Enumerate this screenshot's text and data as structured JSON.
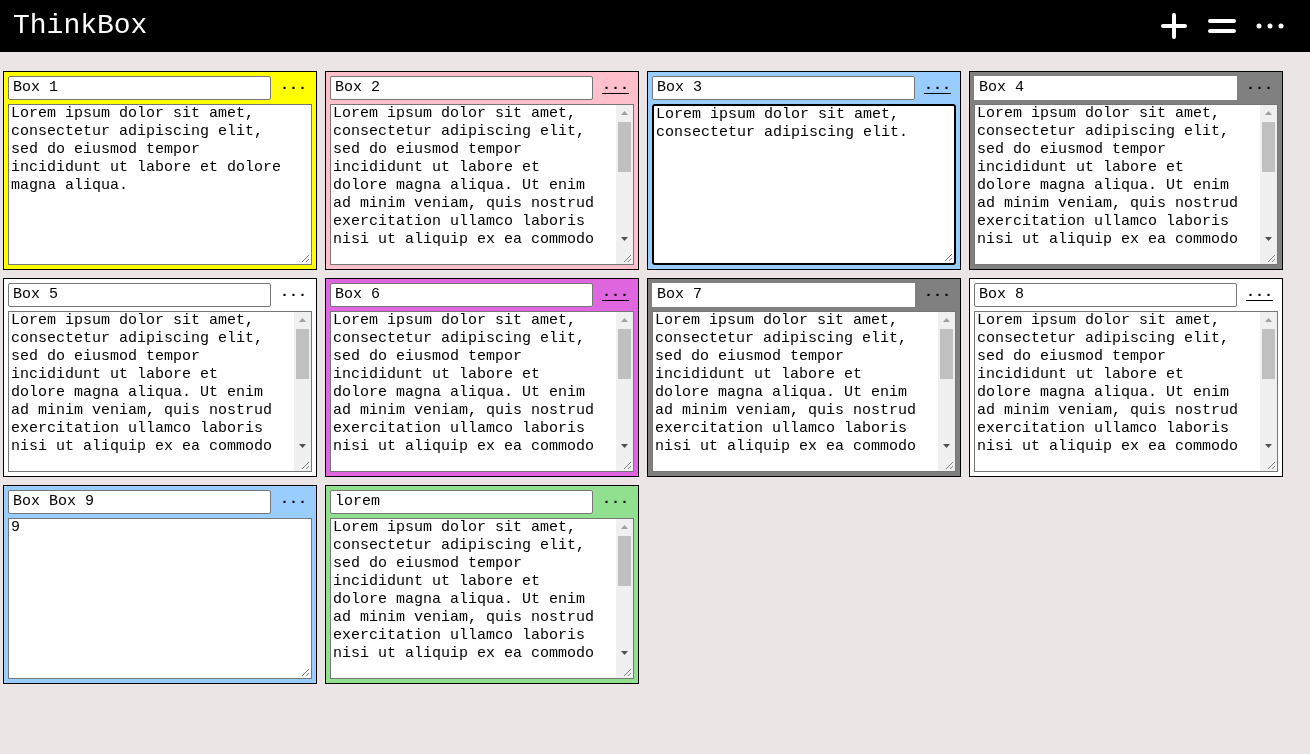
{
  "app": {
    "title": "ThinkBox",
    "actions": [
      {
        "kind": "add"
      },
      {
        "kind": "list"
      },
      {
        "kind": "more"
      }
    ]
  },
  "boxes": [
    {
      "title": "Box 1",
      "color": "#ffff00",
      "menu": "···",
      "menu_underlined": false,
      "focused": false,
      "scrollable": false,
      "text": "Lorem ipsum dolor sit amet, consectetur adipiscing elit, sed do eiusmod tempor incididunt ut labore et dolore magna aliqua."
    },
    {
      "title": "Box 2",
      "color": "#ffc0cb",
      "menu": "···",
      "menu_underlined": true,
      "focused": false,
      "scrollable": true,
      "text": "Lorem ipsum dolor sit amet, consectetur adipiscing elit, sed do eiusmod tempor incididunt ut labore et dolore magna aliqua. Ut enim ad minim veniam, quis nostrud exercitation ullamco laboris nisi ut aliquip ex ea commodo"
    },
    {
      "title": "Box 3",
      "color": "#99ccff",
      "menu": "···",
      "menu_underlined": true,
      "focused": true,
      "scrollable": false,
      "text": "Lorem ipsum dolor sit amet, consectetur adipiscing elit."
    },
    {
      "title": "Box 4",
      "color": "#808080",
      "menu": "···",
      "menu_underlined": false,
      "focused": false,
      "scrollable": true,
      "text": "Lorem ipsum dolor sit amet, consectetur adipiscing elit, sed do eiusmod tempor incididunt ut labore et dolore magna aliqua. Ut enim ad minim veniam, quis nostrud exercitation ullamco laboris nisi ut aliquip ex ea commodo"
    },
    {
      "title": "Box 5",
      "color": "#ffffff",
      "menu": "···",
      "menu_underlined": false,
      "focused": false,
      "scrollable": true,
      "text": "Lorem ipsum dolor sit amet, consectetur adipiscing elit, sed do eiusmod tempor incididunt ut labore et dolore magna aliqua. Ut enim ad minim veniam, quis nostrud exercitation ullamco laboris nisi ut aliquip ex ea commodo"
    },
    {
      "title": "Box 6",
      "color": "#e066e0",
      "menu": "···",
      "menu_underlined": true,
      "focused": false,
      "scrollable": true,
      "text": "Lorem ipsum dolor sit amet, consectetur adipiscing elit, sed do eiusmod tempor incididunt ut labore et dolore magna aliqua. Ut enim ad minim veniam, quis nostrud exercitation ullamco laboris nisi ut aliquip ex ea commodo"
    },
    {
      "title": "Box 7",
      "color": "#808080",
      "menu": "···",
      "menu_underlined": false,
      "focused": false,
      "scrollable": true,
      "text": "Lorem ipsum dolor sit amet, consectetur adipiscing elit, sed do eiusmod tempor incididunt ut labore et dolore magna aliqua. Ut enim ad minim veniam, quis nostrud exercitation ullamco laboris nisi ut aliquip ex ea commodo"
    },
    {
      "title": "Box 8",
      "color": "#ffffff",
      "menu": "···",
      "menu_underlined": true,
      "focused": false,
      "scrollable": true,
      "text": "Lorem ipsum dolor sit amet, consectetur adipiscing elit, sed do eiusmod tempor incididunt ut labore et dolore magna aliqua. Ut enim ad minim veniam, quis nostrud exercitation ullamco laboris nisi ut aliquip ex ea commodo"
    },
    {
      "title": "Box Box 9",
      "color": "#99ccff",
      "menu": "···",
      "menu_underlined": false,
      "focused": false,
      "scrollable": false,
      "text": "9"
    },
    {
      "title": "lorem",
      "color": "#90e090",
      "menu": "···",
      "menu_underlined": false,
      "focused": false,
      "scrollable": true,
      "text": "Lorem ipsum dolor sit amet, consectetur adipiscing elit, sed do eiusmod tempor incididunt ut labore et dolore magna aliqua. Ut enim ad minim veniam, quis nostrud exercitation ullamco laboris nisi ut aliquip ex ea commodo"
    }
  ]
}
